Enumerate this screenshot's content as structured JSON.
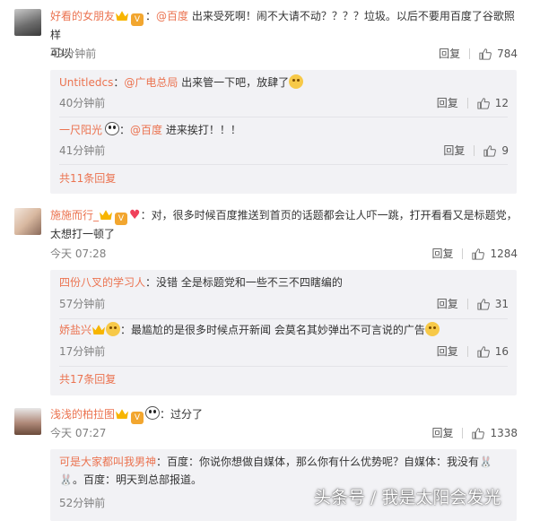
{
  "comments": [
    {
      "username": "好看的女朋友",
      "mention": "@百度",
      "text_line1": " 出来受死啊！闹不大请不动？？？？垃圾。以后不要用百度了谷歌照样",
      "text_line2": "可以",
      "time": "49分钟前",
      "reply": "回复",
      "likes": "784",
      "sub_replies": [
        {
          "username": "Untitledcs",
          "mention": "@广电总局",
          "text": " 出来管一下吧，放肆了",
          "time": "40分钟前",
          "reply": "回复",
          "likes": "12"
        },
        {
          "username": "一尺阳光",
          "mention": "@百度",
          "text": " 进来挨打！！！",
          "time": "41分钟前",
          "reply": "回复",
          "likes": "9"
        }
      ],
      "more": "共11条回复"
    },
    {
      "username": "施施而行_",
      "text_line1": "：对，很多时候百度推送到首页的话题都会让人吓一跳，打开看看又是标题党，",
      "text_line2": "太想打一顿了",
      "time": "今天 07:28",
      "reply": "回复",
      "likes": "1284",
      "sub_replies": [
        {
          "username": "四份八叉的学习人",
          "text": "：没错 全是标题党和一些不三不四瞎编的",
          "time": "57分钟前",
          "reply": "回复",
          "likes": "31"
        },
        {
          "username": "娇盐兴",
          "text": "：最尴尬的是很多时候点开新闻 会莫名其妙弹出不可言说的广告",
          "time": "17分钟前",
          "reply": "回复",
          "likes": "16"
        }
      ],
      "more": "共17条回复"
    },
    {
      "username": "浅浅的柏拉图",
      "text_line1": "：过分了",
      "time": "今天 07:27",
      "reply": "回复",
      "likes": "1338",
      "sub_replies": [
        {
          "username": "可是大家都叫我男神",
          "text": "：百度：你说你想做自媒体，那么你有什么优势呢？自媒体：我没有",
          "text_line2": "。百度：明天到总部报道。",
          "time": "52分钟前"
        }
      ]
    }
  ],
  "watermark": "头条号 / 我是太阳会发光"
}
